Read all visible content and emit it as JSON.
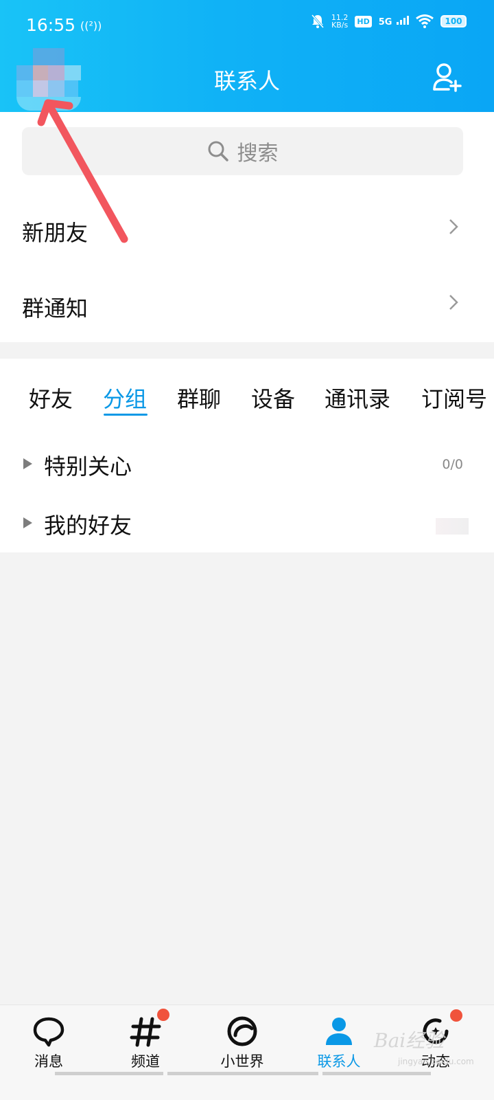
{
  "status_bar": {
    "time": "16:55",
    "hotspot": "((²))",
    "speed_value": "11.2",
    "speed_unit": "KB/s",
    "hd": "HD",
    "network": "5G",
    "battery": "100"
  },
  "header": {
    "title": "联系人",
    "add_friend_icon": "person-add-icon",
    "background": "#10b2f6"
  },
  "search": {
    "placeholder": "搜索",
    "icon": "search-icon"
  },
  "quick_rows": [
    {
      "label": "新朋友"
    },
    {
      "label": "群通知"
    }
  ],
  "tabs": [
    {
      "label": "好友",
      "active": false
    },
    {
      "label": "分组",
      "active": true
    },
    {
      "label": "群聊",
      "active": false
    },
    {
      "label": "设备",
      "active": false
    },
    {
      "label": "通讯录",
      "active": false
    },
    {
      "label": "订阅号",
      "active": false
    }
  ],
  "groups": [
    {
      "label": "特别关心",
      "count": "0/0"
    },
    {
      "label": "我的好友",
      "count": ""
    }
  ],
  "bottom_nav": [
    {
      "label": "消息",
      "icon": "chat-bubble-icon",
      "badge": false,
      "active": false
    },
    {
      "label": "频道",
      "icon": "hashtag-icon",
      "badge": true,
      "active": false
    },
    {
      "label": "小世界",
      "icon": "world-ring-icon",
      "badge": false,
      "active": false
    },
    {
      "label": "联系人",
      "icon": "contacts-person-icon",
      "badge": false,
      "active": true
    },
    {
      "label": "动态",
      "icon": "star-refresh-icon",
      "badge": true,
      "active": false
    }
  ],
  "colors": {
    "accent": "#0a98e6",
    "badge": "#f0533c",
    "annotation_arrow": "#f2565e"
  },
  "watermark": {
    "text": "Bai经验",
    "sub": "jingyan.baidu.com"
  }
}
